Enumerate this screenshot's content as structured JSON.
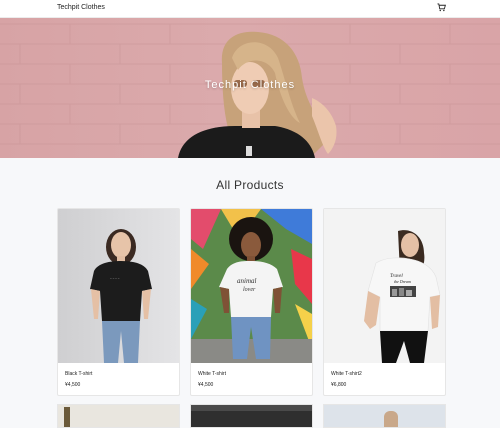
{
  "navbar": {
    "brand": "Techpit Clothes",
    "cart_icon": "shopping-cart-icon"
  },
  "hero": {
    "title": "Techpit Clothes"
  },
  "products_section": {
    "title": "All Products"
  },
  "products": [
    {
      "name": "Black T-shirt",
      "price": "¥4,500"
    },
    {
      "name": "White T-shirt",
      "price": "¥4,500"
    },
    {
      "name": "White T-shirt2",
      "price": "¥6,800"
    }
  ],
  "colors": {
    "hero_pink": "#d9a5a8",
    "page_bg": "#f7f8fa"
  }
}
